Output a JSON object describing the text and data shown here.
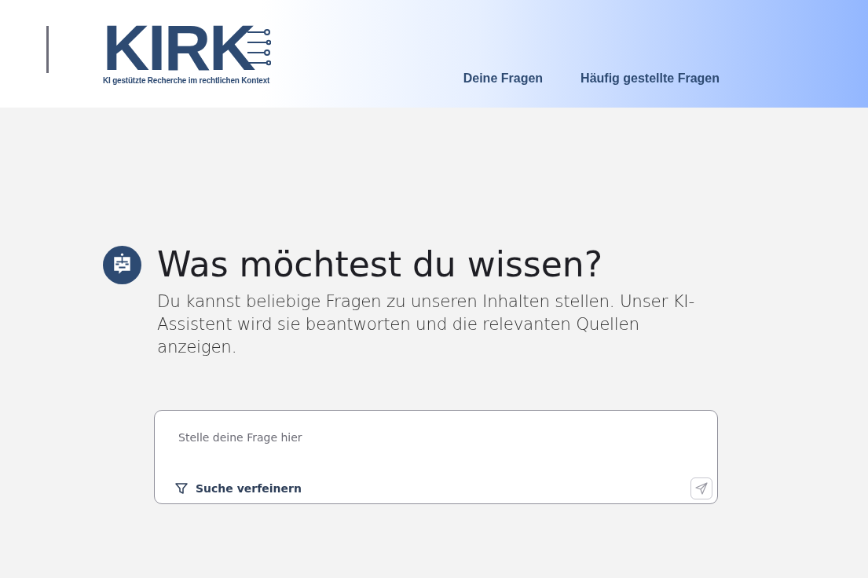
{
  "header": {
    "logo": {
      "wordmark": "KIRK",
      "tagline": "KI gestützte Recherche im rechtlichen Kontext"
    },
    "nav": [
      {
        "label": "Deine Fragen"
      },
      {
        "label": "Häufig gestellte Fragen"
      }
    ]
  },
  "intro": {
    "title": "Was möchtest du wissen?",
    "text": "Du kannst beliebige Fragen zu unseren Inhalten stellen. Unser KI-Assistent wird sie beantworten und die relevanten Quellen anzeigen."
  },
  "question_box": {
    "placeholder": "Stelle deine Frage hier",
    "refine_label": "Suche verfeinern"
  }
}
